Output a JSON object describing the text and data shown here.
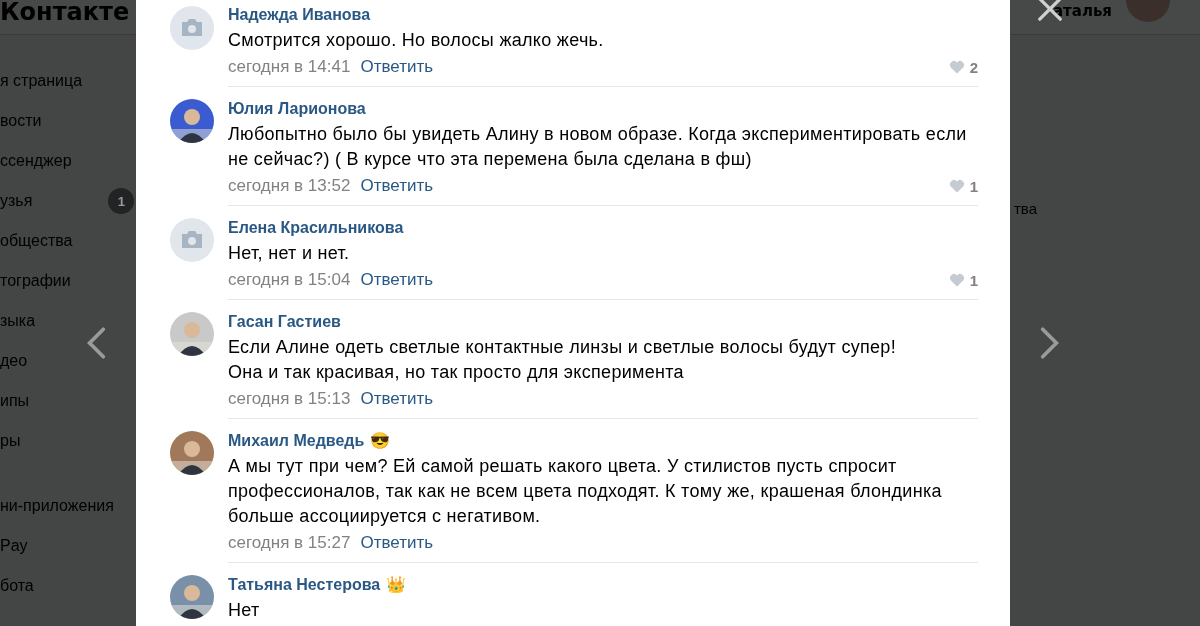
{
  "header": {
    "logo": "Контакте",
    "user_name": "аталья"
  },
  "sidebar": {
    "items": [
      {
        "label": "я страница"
      },
      {
        "label": "вости"
      },
      {
        "label": "ссенджер"
      },
      {
        "label": "узья",
        "badge": "1"
      },
      {
        "label": "общества"
      },
      {
        "label": "тографии"
      },
      {
        "label": "зыка"
      },
      {
        "label": "део"
      },
      {
        "label": "ипы"
      },
      {
        "label": "ры"
      },
      {
        "label": "ни-приложения",
        "gap": true
      },
      {
        "label": "Pay"
      },
      {
        "label": "бота"
      }
    ]
  },
  "background_text": "тва",
  "comments": [
    {
      "author": "Надежда Иванова",
      "avatar": {
        "kind": "placeholder"
      },
      "text": "Смотрится хорошо. Но волосы жалко жечь.",
      "time": "сегодня в 14:41",
      "reply": "Ответить",
      "likes": "2"
    },
    {
      "author": "Юлия Ларионова",
      "text": "Любопытно было бы увидеть Алину в новом образе. Когда экспериментировать если не сейчас?) ( В курсе что эта перемена была сделана в фш)",
      "time": "сегодня в 13:52",
      "reply": "Ответить",
      "likes": "1"
    },
    {
      "author": "Елена Красильникова",
      "avatar": {
        "kind": "placeholder"
      },
      "text": "Нет, нет и нет.",
      "time": "сегодня в 15:04",
      "reply": "Ответить",
      "likes": "1"
    },
    {
      "author": "Гасан Гастиев",
      "text": "Если Алине одеть светлые контактные линзы и светлые волосы будут супер!\nОна и так красивая, но так просто для эксперимента",
      "time": "сегодня в 15:13",
      "reply": "Ответить"
    },
    {
      "author": "Михаил Медведь",
      "emoji": "😎",
      "text": "А мы тут при чем? Ей самой решать какого цвета. У стилистов пусть спросит профессионалов, так как не всем цвета подходят. К тому же, крашеная блондинка больше ассоциируется с негативом.",
      "time": "сегодня в 15:27",
      "reply": "Ответить"
    },
    {
      "author": "Татьяна Нестерова",
      "emoji": "👑",
      "text": "Нет"
    }
  ]
}
